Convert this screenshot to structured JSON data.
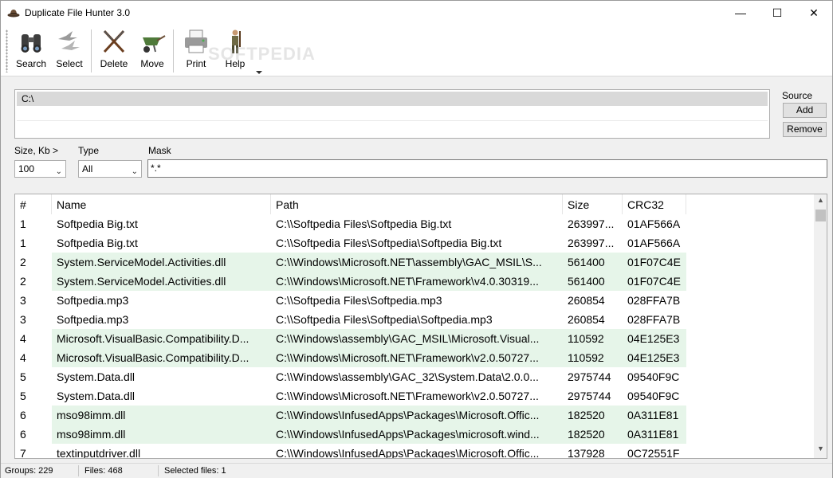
{
  "window": {
    "title": "Duplicate File Hunter 3.0",
    "controls": {
      "minimize": "—",
      "maximize": "☐",
      "close": "✕"
    }
  },
  "toolbar": {
    "buttons": [
      {
        "label": "Search",
        "icon": "binoculars-icon"
      },
      {
        "label": "Select",
        "icon": "birds-icon"
      },
      {
        "label": "Delete",
        "icon": "crossed-rifles-icon"
      },
      {
        "label": "Move",
        "icon": "wheelbarrow-icon"
      },
      {
        "label": "Print",
        "icon": "printer-icon"
      },
      {
        "label": "Help",
        "icon": "hunter-figure-icon"
      }
    ]
  },
  "source": {
    "label": "Source",
    "items": [
      "C:\\"
    ],
    "add_label": "Add",
    "remove_label": "Remove"
  },
  "filters": {
    "size_label": "Size, Kb >",
    "size_value": "100",
    "type_label": "Type",
    "type_value": "All",
    "mask_label": "Mask",
    "mask_value": "*.*"
  },
  "table": {
    "columns": [
      "#",
      "Name",
      "Path",
      "Size",
      "CRC32"
    ],
    "rows": [
      {
        "group": "1",
        "name": "Softpedia Big.txt",
        "path": "C:\\\\Softpedia Files\\Softpedia Big.txt",
        "size": "263997...",
        "crc": "01AF566A",
        "shaded": false
      },
      {
        "group": "1",
        "name": "Softpedia Big.txt",
        "path": "C:\\\\Softpedia Files\\Softpedia\\Softpedia Big.txt",
        "size": "263997...",
        "crc": "01AF566A",
        "shaded": false
      },
      {
        "group": "2",
        "name": "System.ServiceModel.Activities.dll",
        "path": "C:\\\\Windows\\Microsoft.NET\\assembly\\GAC_MSIL\\S...",
        "size": "561400",
        "crc": "01F07C4E",
        "shaded": true
      },
      {
        "group": "2",
        "name": "System.ServiceModel.Activities.dll",
        "path": "C:\\\\Windows\\Microsoft.NET\\Framework\\v4.0.30319...",
        "size": "561400",
        "crc": "01F07C4E",
        "shaded": true
      },
      {
        "group": "3",
        "name": "Softpedia.mp3",
        "path": "C:\\\\Softpedia Files\\Softpedia.mp3",
        "size": "260854",
        "crc": "028FFA7B",
        "shaded": false
      },
      {
        "group": "3",
        "name": "Softpedia.mp3",
        "path": "C:\\\\Softpedia Files\\Softpedia\\Softpedia.mp3",
        "size": "260854",
        "crc": "028FFA7B",
        "shaded": false
      },
      {
        "group": "4",
        "name": "Microsoft.VisualBasic.Compatibility.D...",
        "path": "C:\\\\Windows\\assembly\\GAC_MSIL\\Microsoft.Visual...",
        "size": "110592",
        "crc": "04E125E3",
        "shaded": true
      },
      {
        "group": "4",
        "name": "Microsoft.VisualBasic.Compatibility.D...",
        "path": "C:\\\\Windows\\Microsoft.NET\\Framework\\v2.0.50727...",
        "size": "110592",
        "crc": "04E125E3",
        "shaded": true
      },
      {
        "group": "5",
        "name": "System.Data.dll",
        "path": "C:\\\\Windows\\assembly\\GAC_32\\System.Data\\2.0.0...",
        "size": "2975744",
        "crc": "09540F9C",
        "shaded": false
      },
      {
        "group": "5",
        "name": "System.Data.dll",
        "path": "C:\\\\Windows\\Microsoft.NET\\Framework\\v2.0.50727...",
        "size": "2975744",
        "crc": "09540F9C",
        "shaded": false
      },
      {
        "group": "6",
        "name": "mso98imm.dll",
        "path": "C:\\\\Windows\\InfusedApps\\Packages\\Microsoft.Offic...",
        "size": "182520",
        "crc": "0A311E81",
        "shaded": true
      },
      {
        "group": "6",
        "name": "mso98imm.dll",
        "path": "C:\\\\Windows\\InfusedApps\\Packages\\microsoft.wind...",
        "size": "182520",
        "crc": "0A311E81",
        "shaded": true
      },
      {
        "group": "7",
        "name": "textinputdriver.dll",
        "path": "C:\\\\Windows\\InfusedApps\\Packages\\Microsoft.Offic...",
        "size": "137928",
        "crc": "0C72551F",
        "shaded": false
      }
    ]
  },
  "status": {
    "groups": "Groups: 229",
    "files": "Files: 468",
    "selected": "Selected files: 1"
  },
  "watermark": "SOFTPEDIA",
  "colors": {
    "shaded_row": "#e6f5e9",
    "source_selected": "#d9d9d9"
  }
}
